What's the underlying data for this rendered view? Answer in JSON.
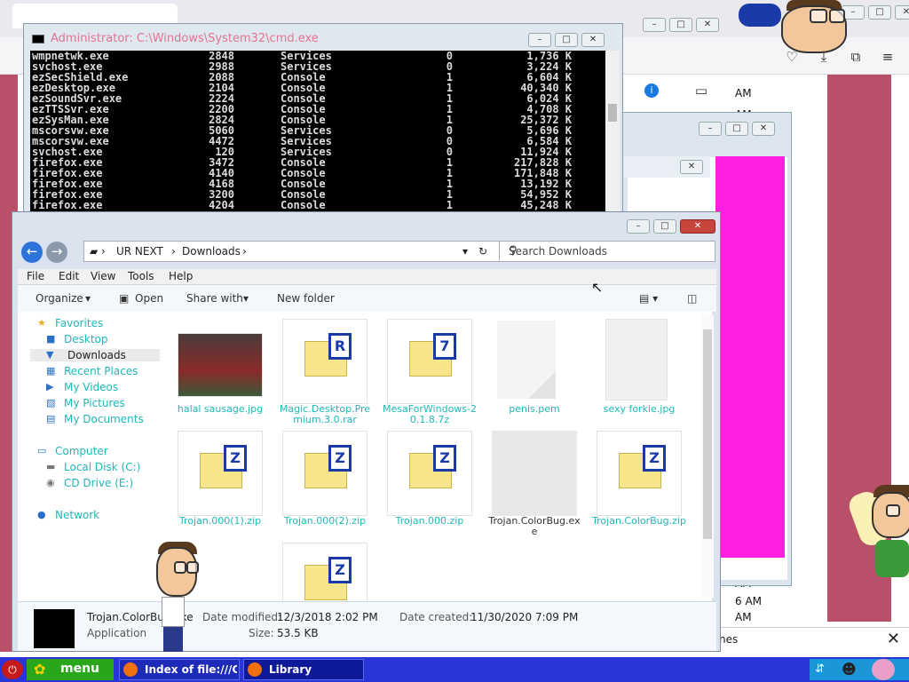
{
  "cmd": {
    "title": "Administrator: C:\\Windows\\System32\\cmd.exe",
    "rows": [
      {
        "name": "wmpnetwk.exe",
        "pid": "2848",
        "session": "Services",
        "num": "0",
        "mem": "1,736 K"
      },
      {
        "name": "svchost.exe",
        "pid": "2988",
        "session": "Services",
        "num": "0",
        "mem": "3,224 K"
      },
      {
        "name": "ezSecShield.exe",
        "pid": "2088",
        "session": "Console",
        "num": "1",
        "mem": "6,604 K"
      },
      {
        "name": "ezDesktop.exe",
        "pid": "2104",
        "session": "Console",
        "num": "1",
        "mem": "40,340 K"
      },
      {
        "name": "ezSoundSvr.exe",
        "pid": "2224",
        "session": "Console",
        "num": "1",
        "mem": "6,024 K"
      },
      {
        "name": "ezTTSSvr.exe",
        "pid": "2200",
        "session": "Console",
        "num": "1",
        "mem": "4,708 K"
      },
      {
        "name": "ezSysMan.exe",
        "pid": "2824",
        "session": "Console",
        "num": "1",
        "mem": "25,372 K"
      },
      {
        "name": "mscorsvw.exe",
        "pid": "5060",
        "session": "Services",
        "num": "0",
        "mem": "5,696 K"
      },
      {
        "name": "mscorsvw.exe",
        "pid": "4472",
        "session": "Services",
        "num": "0",
        "mem": "6,584 K"
      },
      {
        "name": "svchost.exe",
        "pid": "120",
        "session": "Services",
        "num": "0",
        "mem": "11,924 K"
      },
      {
        "name": "firefox.exe",
        "pid": "3472",
        "session": "Console",
        "num": "1",
        "mem": "217,828 K"
      },
      {
        "name": "firefox.exe",
        "pid": "4140",
        "session": "Console",
        "num": "1",
        "mem": "171,848 K"
      },
      {
        "name": "firefox.exe",
        "pid": "4168",
        "session": "Console",
        "num": "1",
        "mem": "13,192 K"
      },
      {
        "name": "firefox.exe",
        "pid": "3200",
        "session": "Console",
        "num": "1",
        "mem": "54,952 K"
      },
      {
        "name": "firefox.exe",
        "pid": "4204",
        "session": "Console",
        "num": "1",
        "mem": "45,248 K"
      }
    ]
  },
  "explorer": {
    "breadcrumb": [
      "UR NEXT",
      "Downloads"
    ],
    "search_placeholder": "Search Downloads",
    "menu": [
      "File",
      "Edit",
      "View",
      "Tools",
      "Help"
    ],
    "commands": {
      "organize": "Organize",
      "open": "Open",
      "share": "Share with",
      "new_folder": "New folder"
    },
    "nav": {
      "favorites": "Favorites",
      "desktop": "Desktop",
      "downloads": "Downloads",
      "recent": "Recent Places",
      "videos": "My Videos",
      "pictures": "My Pictures",
      "documents": "My Documents",
      "computer": "Computer",
      "local_disk": "Local Disk (C:)",
      "cd_drive": "CD Drive (E:)",
      "network": "Network"
    },
    "files": [
      {
        "label": "halal sausage.jpg",
        "badge": ""
      },
      {
        "label": "Magic.Desktop.Premium.3.0.rar",
        "badge": "R"
      },
      {
        "label": "MesaForWindows-20.1.8.7z",
        "badge": "7"
      },
      {
        "label": "penis.pem",
        "badge": ""
      },
      {
        "label": "sexy forkie.jpg",
        "badge": ""
      },
      {
        "label": "Trojan.000(1).zip",
        "badge": "Z"
      },
      {
        "label": "Trojan.000(2).zip",
        "badge": "Z"
      },
      {
        "label": "Trojan.000.zip",
        "badge": "Z"
      },
      {
        "label": "Trojan.ColorBug.exe",
        "badge": ""
      },
      {
        "label": "Trojan.ColorBug.zip",
        "badge": "Z"
      },
      {
        "label": "",
        "badge": "Z"
      }
    ],
    "details": {
      "name": "Trojan.ColorBug.exe",
      "type": "Application",
      "modified_label": "Date modified:",
      "modified": "12/3/2018 2:02 PM",
      "created_label": "Date created:",
      "created": "11/30/2020 7:09 PM",
      "size_label": "Size:",
      "size": "53.5 KB"
    }
  },
  "background": {
    "times": [
      "AM",
      "AM",
      "AM",
      "AM",
      "6 AM",
      "AM"
    ],
    "find_text": "nes"
  },
  "taskbar": {
    "menu_label": "menu",
    "tasks": [
      "Index of file:///C:...",
      "Library"
    ]
  },
  "colors": {
    "taskbar": "#2a35d8",
    "menu_button": "#2aa61c",
    "nav_text": "#1fb8b8",
    "magenta_panel": "#ff1fe0",
    "desktop": "#b8506a"
  }
}
